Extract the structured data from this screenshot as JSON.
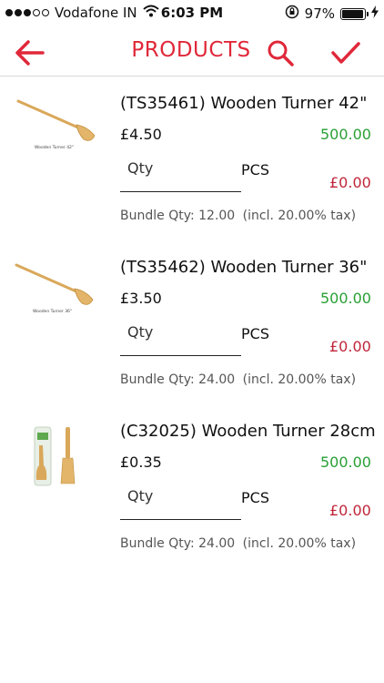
{
  "status_bar": {
    "carrier": "Vodafone IN",
    "time": "6:03 PM",
    "battery_percent": "97%",
    "battery_level": 0.97,
    "signal_bars_filled": 3,
    "signal_bars_total": 5
  },
  "nav": {
    "title": "PRODUCTS",
    "accent_color": "#e0283a"
  },
  "products": [
    {
      "name": "(TS35461) Wooden Turner 42\"",
      "price": "£4.50",
      "stock": "500.00",
      "qty_placeholder": "Qty",
      "unit": "PCS",
      "total": "£0.00",
      "bundle": "Bundle Qty: 12.00",
      "tax": "(incl. 20.00% tax)",
      "image_caption": "Wooden Turner 42\"",
      "image_type": "single-turner"
    },
    {
      "name": "(TS35462) Wooden Turner 36\"",
      "price": "£3.50",
      "stock": "500.00",
      "qty_placeholder": "Qty",
      "unit": "PCS",
      "total": "£0.00",
      "bundle": "Bundle Qty: 24.00",
      "tax": "(incl. 20.00% tax)",
      "image_caption": "Wooden Turner 36\"",
      "image_type": "single-turner"
    },
    {
      "name": "(C32025) Wooden Turner 28cm",
      "price": "£0.35",
      "stock": "500.00",
      "qty_placeholder": "Qty",
      "unit": "PCS",
      "total": "£0.00",
      "bundle": "Bundle Qty: 24.00",
      "tax": "(incl. 20.00% tax)",
      "image_caption": "",
      "image_type": "packaged-turners"
    }
  ]
}
